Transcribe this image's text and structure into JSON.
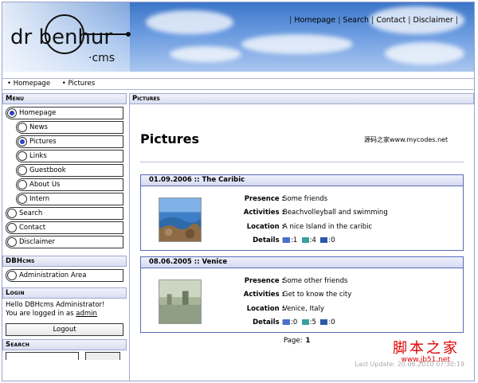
{
  "banner": {
    "logo_text": "dr benhur",
    "logo_sub": "·cms",
    "topnav": [
      "Homepage",
      "Search",
      "Contact",
      "Disclaimer"
    ]
  },
  "breadcrumb": [
    "Homepage",
    "Pictures"
  ],
  "menu": {
    "title": "Menu",
    "items": [
      {
        "label": "Homepage",
        "level": 0,
        "selected": true
      },
      {
        "label": "News",
        "level": 1,
        "selected": false
      },
      {
        "label": "Pictures",
        "level": 1,
        "selected": true
      },
      {
        "label": "Links",
        "level": 1,
        "selected": false
      },
      {
        "label": "Guestbook",
        "level": 1,
        "selected": false
      },
      {
        "label": "About Us",
        "level": 1,
        "selected": false
      },
      {
        "label": "Intern",
        "level": 1,
        "selected": false
      },
      {
        "label": "Search",
        "level": 0,
        "selected": false
      },
      {
        "label": "Contact",
        "level": 0,
        "selected": false
      },
      {
        "label": "Disclaimer",
        "level": 0,
        "selected": false
      }
    ]
  },
  "dbhcms": {
    "title": "DBHcms",
    "item": "Administration Area"
  },
  "login": {
    "title": "Login",
    "line1": "Hello DBHcms Administrator!",
    "line2": "You are logged in as",
    "user": "admin",
    "button": "Logout"
  },
  "search": {
    "title": "Search"
  },
  "main": {
    "head": "Pictures",
    "title": "Pictures",
    "mark": "源码之家www.mycodes.net"
  },
  "entries": [
    {
      "header": "01.09.2006 :: The Caribic",
      "presence_label": "Presence :",
      "presence": "Some friends",
      "activities_label": "Activities :",
      "activities": "Beachvolleyball and swimming",
      "location_label": "Location :",
      "location": "A nice Island in the caribic",
      "details_label": "Details :",
      "d1": ":1",
      "d2": ":4",
      "d3": ":0"
    },
    {
      "header": "08.06.2005 :: Venice",
      "presence_label": "Presence :",
      "presence": "Some other friends",
      "activities_label": "Activities :",
      "activities": "Get to know the city",
      "location_label": "Location :",
      "location": "Venice, Italy",
      "details_label": "Details :",
      "d1": ":0",
      "d2": ":5",
      "d3": ":0"
    }
  ],
  "pager": {
    "label": "Page:",
    "page": "1"
  },
  "last_update": "Last Update: 20.06.2010 07:30:19",
  "watermark": {
    "big": "脚本之家",
    "small": "www.jb51.net"
  },
  "colors": {
    "accent": "#2d44c8",
    "border": "#5a6ab8",
    "header_bg": "#d9ddf0"
  }
}
